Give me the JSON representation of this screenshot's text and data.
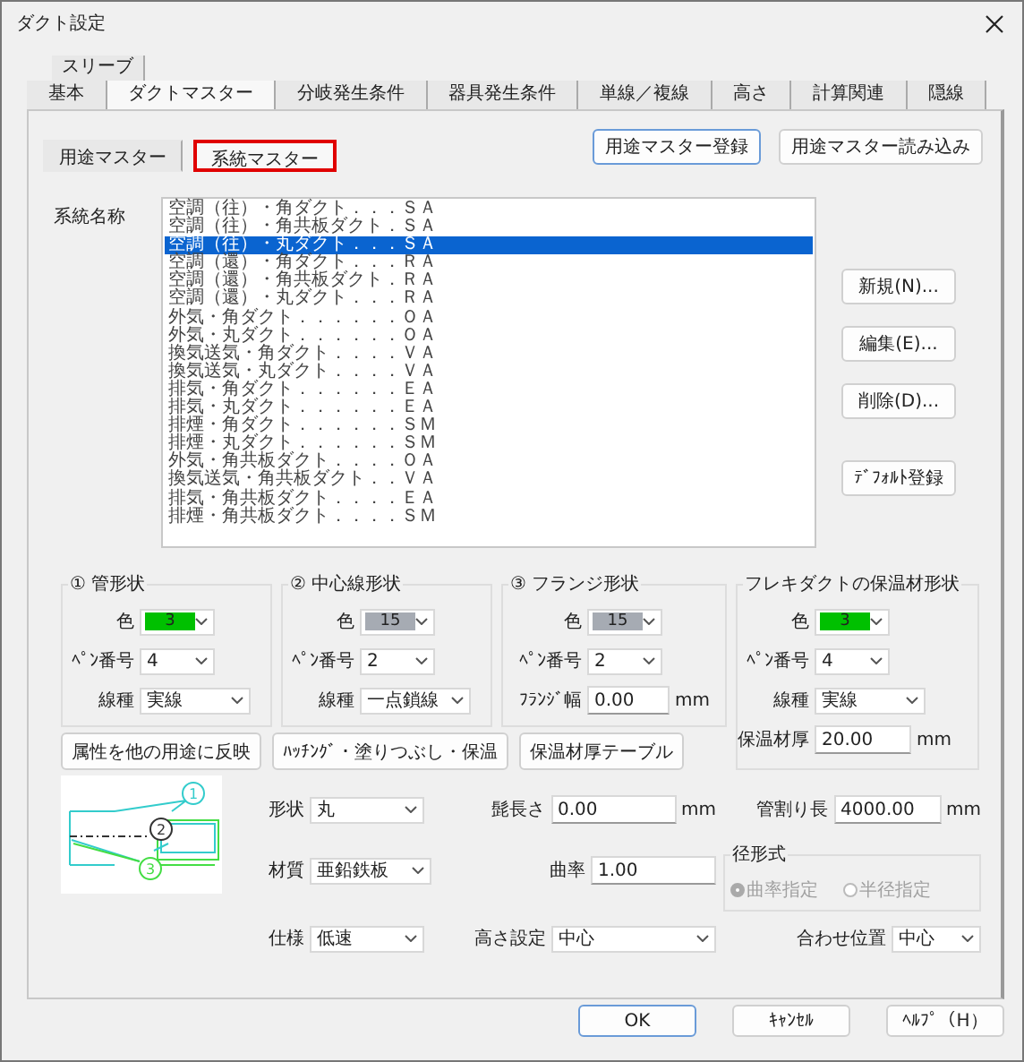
{
  "window": {
    "title": "ダクト設定"
  },
  "tabs_upper": [
    {
      "label": "スリーブ",
      "selected": false
    }
  ],
  "tabs": [
    {
      "label": "基本",
      "selected": false
    },
    {
      "label": "ダクトマスター",
      "selected": true
    },
    {
      "label": "分岐発生条件",
      "selected": false
    },
    {
      "label": "器具発生条件",
      "selected": false
    },
    {
      "label": "単線／複線",
      "selected": false
    },
    {
      "label": "高さ",
      "selected": false
    },
    {
      "label": "計算関連",
      "selected": false
    },
    {
      "label": "隠線",
      "selected": false
    }
  ],
  "subtabs": [
    {
      "label": "用途マスター",
      "selected": false,
      "highlighted": false
    },
    {
      "label": "系統マスター",
      "selected": true,
      "highlighted": true
    }
  ],
  "top_buttons": [
    {
      "label": "用途マスター登録",
      "default": true
    },
    {
      "label": "用途マスター読み込み",
      "default": false
    }
  ],
  "system_list": {
    "label": "系統名称",
    "items": [
      {
        "text": "空調（往）・角ダクト．．．ＳＡ",
        "selected": false
      },
      {
        "text": "空調（往）・角共板ダクト．ＳＡ",
        "selected": false
      },
      {
        "text": "空調（往）・丸ダクト．．．ＳＡ",
        "selected": true
      },
      {
        "text": "空調（還）・角ダクト．．．ＲＡ",
        "selected": false
      },
      {
        "text": "空調（還）・角共板ダクト．ＲＡ",
        "selected": false
      },
      {
        "text": "空調（還）・丸ダクト．．．ＲＡ",
        "selected": false
      },
      {
        "text": "外気・角ダクト．．．．．．ＯＡ",
        "selected": false
      },
      {
        "text": "外気・丸ダクト．．．．．．ＯＡ",
        "selected": false
      },
      {
        "text": "換気送気・角ダクト．．．．ＶＡ",
        "selected": false
      },
      {
        "text": "換気送気・丸ダクト．．．．ＶＡ",
        "selected": false
      },
      {
        "text": "排気・角ダクト．．．．．．ＥＡ",
        "selected": false
      },
      {
        "text": "排気・丸ダクト．．．．．．ＥＡ",
        "selected": false
      },
      {
        "text": "排煙・角ダクト．．．．．．ＳＭ",
        "selected": false
      },
      {
        "text": "排煙・丸ダクト．．．．．．ＳＭ",
        "selected": false
      },
      {
        "text": "外気・角共板ダクト．．．．ＯＡ",
        "selected": false
      },
      {
        "text": "換気送気・角共板ダクト．．ＶＡ",
        "selected": false
      },
      {
        "text": "排気・角共板ダクト．．．．ＥＡ",
        "selected": false
      },
      {
        "text": "排煙・角共板ダクト．．．．ＳＭ",
        "selected": false
      }
    ]
  },
  "side_buttons": [
    "新規(N)...",
    "編集(E)...",
    "削除(D)...",
    "ﾃﾞﾌｫﾙﾄ登録"
  ],
  "groups": [
    {
      "title": "① 管形状",
      "fields": [
        {
          "kind": "color",
          "label": "色",
          "value": "3",
          "color": "#00c000"
        },
        {
          "kind": "select",
          "label": "ﾍﾟﾝ番号",
          "value": "4"
        },
        {
          "kind": "select",
          "label": "線種",
          "value": "実線"
        }
      ]
    },
    {
      "title": "② 中心線形状",
      "fields": [
        {
          "kind": "color",
          "label": "色",
          "value": "15",
          "color": "#a6abb3"
        },
        {
          "kind": "select",
          "label": "ﾍﾟﾝ番号",
          "value": "2"
        },
        {
          "kind": "select",
          "label": "線種",
          "value": "一点鎖線"
        }
      ]
    },
    {
      "title": "③ フランジ形状",
      "fields": [
        {
          "kind": "color",
          "label": "色",
          "value": "15",
          "color": "#a6abb3"
        },
        {
          "kind": "select",
          "label": "ﾍﾟﾝ番号",
          "value": "2"
        },
        {
          "kind": "input",
          "label": "ﾌﾗﾝｼﾞ幅",
          "value": "0.00",
          "unit": "mm"
        }
      ]
    },
    {
      "title": "フレキダクトの保温材形状",
      "fields": [
        {
          "kind": "color",
          "label": "色",
          "value": "3",
          "color": "#00c000"
        },
        {
          "kind": "select",
          "label": "ﾍﾟﾝ番号",
          "value": "4"
        },
        {
          "kind": "select",
          "label": "線種",
          "value": "実線"
        },
        {
          "kind": "input",
          "label": "保温材厚",
          "value": "20.00",
          "unit": "mm"
        }
      ]
    }
  ],
  "action_buttons": [
    "属性を他の用途に反映",
    "ﾊｯﾁﾝｸﾞ・塗りつぶし・保温",
    "保温材厚テーブル"
  ],
  "diagram": {
    "callouts": [
      "1",
      "2",
      "3"
    ]
  },
  "form": [
    {
      "kind": "select",
      "label": "形状",
      "value": "丸"
    },
    {
      "kind": "input",
      "label": "髭長さ",
      "value": "0.00",
      "unit": "mm"
    },
    {
      "kind": "input",
      "label": "管割り長",
      "value": "4000.00",
      "unit": "mm"
    },
    {
      "kind": "select",
      "label": "材質",
      "value": "亜鉛鉄板"
    },
    {
      "kind": "input",
      "label": "曲率",
      "value": "1.00"
    },
    {
      "kind": "radios",
      "label": "径形式",
      "disabled": true,
      "options": [
        {
          "label": "曲率指定",
          "selected": true
        },
        {
          "label": "半径指定",
          "selected": false
        }
      ]
    },
    {
      "kind": "select",
      "label": "仕様",
      "value": "低速"
    },
    {
      "kind": "select",
      "label": "高さ設定",
      "value": "中心"
    },
    {
      "kind": "select",
      "label": "合わせ位置",
      "value": "中心"
    }
  ],
  "footer_buttons": [
    {
      "label": "OK",
      "default": true
    },
    {
      "label": "ｷｬﾝｾﾙ",
      "default": false
    },
    {
      "label": "ﾍﾙﾌﾟ（H）",
      "default": false
    }
  ]
}
